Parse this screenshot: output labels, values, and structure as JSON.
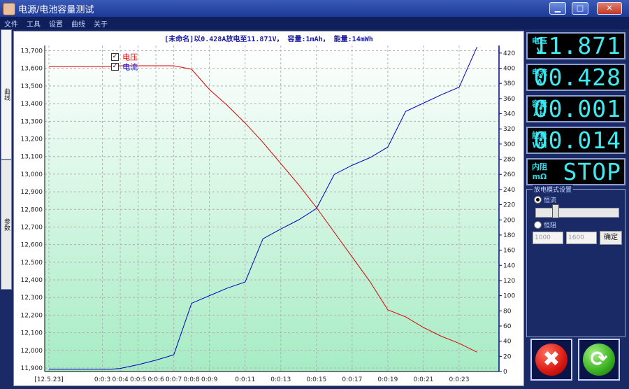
{
  "window": {
    "title": "电源/电池容量测试",
    "minimize": "▁",
    "maximize": "□",
    "close": "✕"
  },
  "menu": [
    "文件",
    "工具",
    "设置",
    "曲线",
    "关于"
  ],
  "side_tabs": [
    "曲线",
    "参数"
  ],
  "chart": {
    "title": "[未命名]以0.428A放电至11.871V， 容量:1mAh， 能量:14mWh",
    "legend": [
      {
        "label": "电压",
        "color": "#e00000",
        "checked": true
      },
      {
        "label": "电流",
        "color": "#0000c0",
        "checked": true
      }
    ]
  },
  "chart_data": {
    "type": "line",
    "grid": true,
    "x_tick_labels": [
      "[12.5.23]",
      "0:0:3",
      "0:0:4",
      "0:0:5",
      "0:0:6",
      "0:0:7",
      "0:0:8",
      "0:0:9",
      "0:0:11",
      "0:0:13",
      "0:0:15",
      "0:0:17",
      "0:0:19",
      "0:0:21",
      "0:0:23"
    ],
    "y_left": {
      "ylim": [
        11880,
        13730
      ],
      "ticks": [
        11900,
        12000,
        12100,
        12200,
        12300,
        12400,
        12500,
        12600,
        12700,
        12800,
        12900,
        13000,
        13100,
        13200,
        13300,
        13400,
        13500,
        13600,
        13700
      ]
    },
    "y_right": {
      "ylim": [
        0,
        430
      ],
      "ticks": [
        0,
        20,
        40,
        60,
        80,
        100,
        120,
        140,
        160,
        180,
        200,
        220,
        240,
        260,
        280,
        300,
        320,
        340,
        360,
        380,
        400,
        420
      ]
    },
    "series": [
      {
        "name": "电压",
        "axis": "left",
        "color": "#e00000",
        "x": [
          0,
          3.5,
          4,
          7,
          8,
          9,
          10,
          11,
          12,
          13,
          14,
          15,
          16,
          17,
          18,
          19,
          20,
          21,
          22,
          23,
          24
        ],
        "y": [
          13610,
          13610,
          13615,
          13615,
          13595,
          13480,
          13390,
          13290,
          13180,
          13060,
          12940,
          12810,
          12670,
          12530,
          12390,
          12230,
          12190,
          12130,
          12080,
          12040,
          11990
        ]
      },
      {
        "name": "电流",
        "axis": "right",
        "color": "#0000c0",
        "x": [
          0,
          3.5,
          4,
          5,
          6,
          7,
          8,
          9,
          10,
          11,
          12,
          13,
          14,
          15,
          16,
          17,
          18,
          19,
          20,
          21,
          22,
          23,
          24
        ],
        "y": [
          3,
          3,
          4,
          9,
          15,
          22,
          90,
          100,
          110,
          118,
          175,
          188,
          200,
          215,
          260,
          272,
          282,
          296,
          343,
          354,
          365,
          375,
          428
        ]
      }
    ]
  },
  "meters": [
    {
      "label": "电压",
      "unit": "V",
      "value": "11.871"
    },
    {
      "label": "电流",
      "unit": "A",
      "value": "00.428"
    },
    {
      "label": "容量",
      "unit": "AH",
      "value": "00.001"
    },
    {
      "label": "能量",
      "unit": "WH",
      "value": "00.014"
    },
    {
      "label": "内阻",
      "unit": "mΩ",
      "value": "STOP"
    }
  ],
  "controls": {
    "group_title": "放电模式设置",
    "radio_1": "恒流",
    "radio_2": "恒阻",
    "field_1": "1000",
    "field_2": "1600",
    "confirm": "确定"
  }
}
